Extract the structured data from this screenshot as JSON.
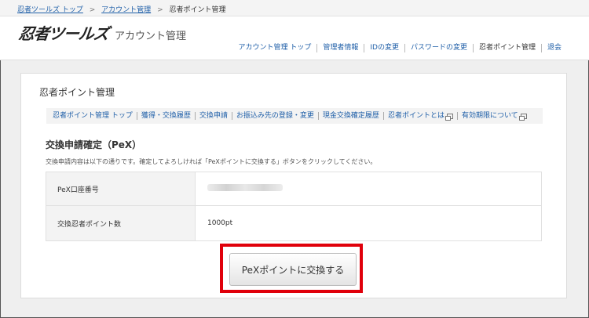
{
  "breadcrumb": {
    "items": [
      "忍者ツールズ トップ",
      "アカウント管理"
    ],
    "separator": ">",
    "current": "忍者ポイント管理"
  },
  "header": {
    "logo": "忍者ツールズ",
    "section_title": "アカウント管理",
    "nav": [
      "アカウント管理 トップ",
      "管理者情報",
      "IDの変更",
      "パスワードの変更",
      "忍者ポイント管理",
      "退会"
    ]
  },
  "panel": {
    "title": "忍者ポイント管理",
    "subnav": [
      "忍者ポイント管理 トップ",
      "獲得・交換履歴",
      "交換申請",
      "お振込み先の登録・変更",
      "現金交換確定履歴",
      "忍者ポイントとは",
      "有効期限について"
    ]
  },
  "confirm": {
    "title": "交換申請確定（PeX）",
    "description": "交換申請内容は以下の通りです。確定してよろしければ「PeXポイントに交換する」ボタンをクリックしてください。",
    "rows": [
      {
        "label": "PeX口座番号",
        "value": ""
      },
      {
        "label": "交換忍者ポイント数",
        "value": "1000pt"
      }
    ],
    "button_label": "PeXポイントに交換する"
  },
  "colors": {
    "link": "#1f5fa8",
    "highlight": "#e0000b",
    "background": "#efefef"
  },
  "icons": {
    "external_link": "external-link-icon"
  }
}
